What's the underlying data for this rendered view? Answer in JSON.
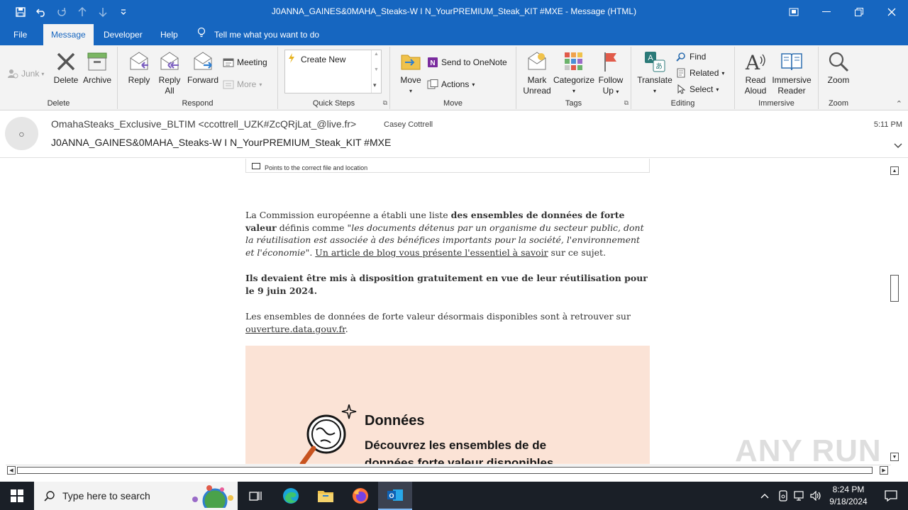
{
  "window": {
    "title": "J0ANNA_GAINES&0MAHA_Steaks-W I N_YourPREMIUM_Steak_KIT #MXE  -  Message (HTML)"
  },
  "tabs": [
    "File",
    "Message",
    "Developer",
    "Help"
  ],
  "tellme": "Tell me what you want to do",
  "ribbon": {
    "junk": "Junk",
    "delete": "Delete",
    "archive": "Archive",
    "delete_group": "Delete",
    "reply": "Reply",
    "reply_all_1": "Reply",
    "reply_all_2": "All",
    "forward": "Forward",
    "meeting": "Meeting",
    "more": "More",
    "respond_group": "Respond",
    "quick_create": "Create New",
    "quicksteps_group": "Quick Steps",
    "move": "Move",
    "onenote": "Send to OneNote",
    "actions": "Actions",
    "move_group": "Move",
    "mark_unread_1": "Mark",
    "mark_unread_2": "Unread",
    "categorize": "Categorize",
    "follow_up_1": "Follow",
    "follow_up_2": "Up",
    "tags_group": "Tags",
    "translate": "Translate",
    "find": "Find",
    "related": "Related",
    "select": "Select",
    "editing_group": "Editing",
    "read_aloud_1": "Read",
    "read_aloud_2": "Aloud",
    "immersive_1": "Immersive",
    "immersive_2": "Reader",
    "immersive_group": "Immersive",
    "zoom": "Zoom",
    "zoom_group": "Zoom"
  },
  "message": {
    "from": "OmahaSteaks_Exclusive_BLTIM <ccottrell_UZK#ZcQRjLat_@live.fr>",
    "to": "Casey Cottrell",
    "subject": "J0ANNA_GAINES&0MAHA_Steaks-W I N_YourPREMIUM_Steak_KIT  #MXE",
    "time": "5:11 PM",
    "cut_line": "Points to the correct file and location",
    "p1_a": "La Commission européenne a établi une liste ",
    "p1_b": "des ensembles de données de forte valeur",
    "p1_c": " définis comme ",
    "p1_d": "\"les documents détenus par un organisme du secteur public, dont la réutilisation est associée à des bénéfices importants pour la société, l'environnement et l'économie\"",
    "p1_e": ". ",
    "p1_link": "Un article de blog vous présente l'essentiel à savoir",
    "p1_f": " sur ce sujet.",
    "p2": "Ils devaient être mis à disposition gratuitement en vue de leur réutilisation pour le 9 juin 2024.",
    "p3_a": "Les ensembles de données de forte valeur désormais disponibles sont à retrouver sur ",
    "p3_link": "ouverture.data.gouv.fr",
    "p3_b": ".",
    "banner_title": "Données",
    "banner_line1": "Découvrez les ensembles de de",
    "banner_line2": "données forte valeur disponibles"
  },
  "watermark": "ANY RUN",
  "taskbar": {
    "search_placeholder": "Type here to search",
    "time": "8:24 PM",
    "date": "9/18/2024"
  }
}
